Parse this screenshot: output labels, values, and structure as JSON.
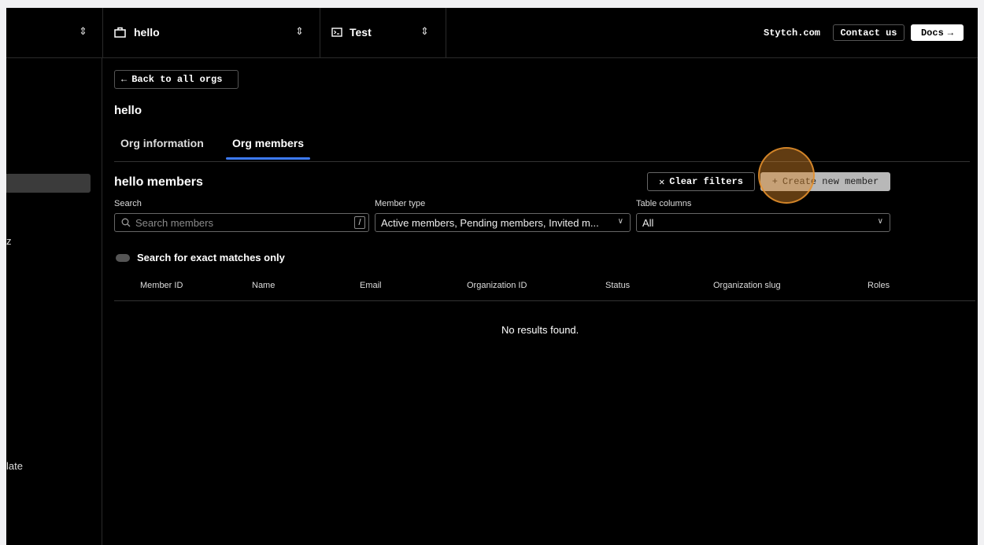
{
  "topbar": {
    "org_selector": "hello",
    "env_selector": "Test",
    "stytch_link": "Stytch.com",
    "contact_button": "Contact us",
    "docs_button": "Docs"
  },
  "sidebar": {
    "partial_label": "late",
    "partial_glyph": "z"
  },
  "main": {
    "back_button": "Back to all orgs",
    "org_title": "hello",
    "tabs": [
      {
        "label": "Org information",
        "active": false
      },
      {
        "label": "Org members",
        "active": true
      }
    ],
    "section_title": "hello members",
    "clear_filters_button": "Clear filters",
    "create_member_button": "Create new member",
    "search": {
      "label": "Search",
      "placeholder": "Search members",
      "shortcut": "/"
    },
    "member_type": {
      "label": "Member type",
      "value": "Active members, Pending members, Invited m..."
    },
    "table_columns": {
      "label": "Table columns",
      "value": "All"
    },
    "exact_match_toggle": "Search for exact matches only",
    "table": {
      "columns": [
        "Member ID",
        "Name",
        "Email",
        "Organization ID",
        "Status",
        "Organization slug",
        "Roles"
      ],
      "empty_text": "No results found."
    }
  },
  "colors": {
    "accent": "#3d7af5",
    "highlight": "#e6912d",
    "background": "#000000"
  }
}
